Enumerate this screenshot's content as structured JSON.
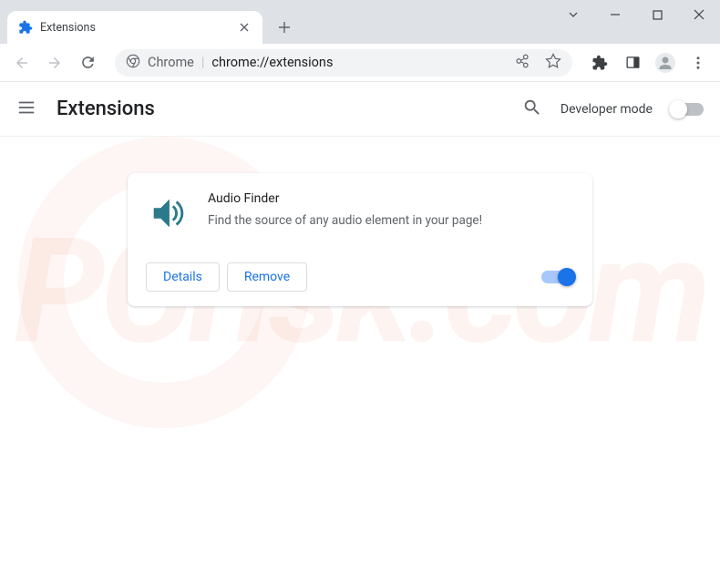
{
  "tab": {
    "title": "Extensions"
  },
  "omnibox": {
    "prefix": "Chrome",
    "url": "chrome://extensions"
  },
  "header": {
    "title": "Extensions",
    "developer_mode_label": "Developer mode"
  },
  "extension": {
    "name": "Audio Finder",
    "description": "Find the source of any audio element in your page!",
    "details_label": "Details",
    "remove_label": "Remove"
  }
}
